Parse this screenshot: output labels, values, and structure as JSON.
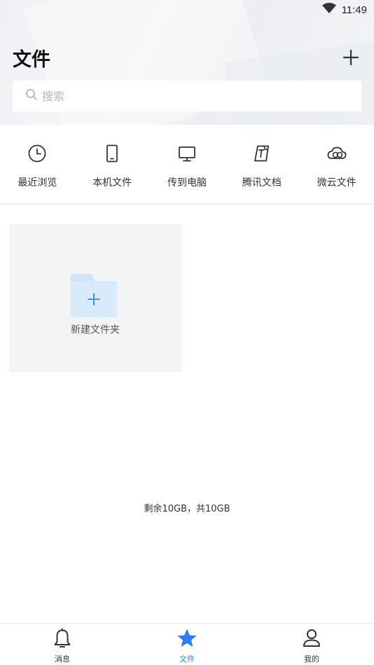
{
  "status_bar": {
    "time": "11:49"
  },
  "header": {
    "title": "文件"
  },
  "search": {
    "placeholder": "搜索"
  },
  "shortcuts": [
    {
      "label": "最近浏览",
      "icon": "clock-icon"
    },
    {
      "label": "本机文件",
      "icon": "phone-icon"
    },
    {
      "label": "传到电脑",
      "icon": "monitor-icon"
    },
    {
      "label": "腾讯文档",
      "icon": "tencent-docs-icon"
    },
    {
      "label": "微云文件",
      "icon": "cloud-icon"
    }
  ],
  "new_folder": {
    "label": "新建文件夹"
  },
  "storage": {
    "text": "剩余10GB，共10GB"
  },
  "bottom_nav": [
    {
      "label": "消息",
      "icon": "bell-icon",
      "active": false
    },
    {
      "label": "文件",
      "icon": "star-icon",
      "active": true
    },
    {
      "label": "我的",
      "icon": "person-icon",
      "active": false
    }
  ],
  "colors": {
    "accent": "#2f7df6",
    "folder": "#cfe4f8",
    "folder_plus": "#2f8be6",
    "card_bg": "#f3f4f6"
  }
}
